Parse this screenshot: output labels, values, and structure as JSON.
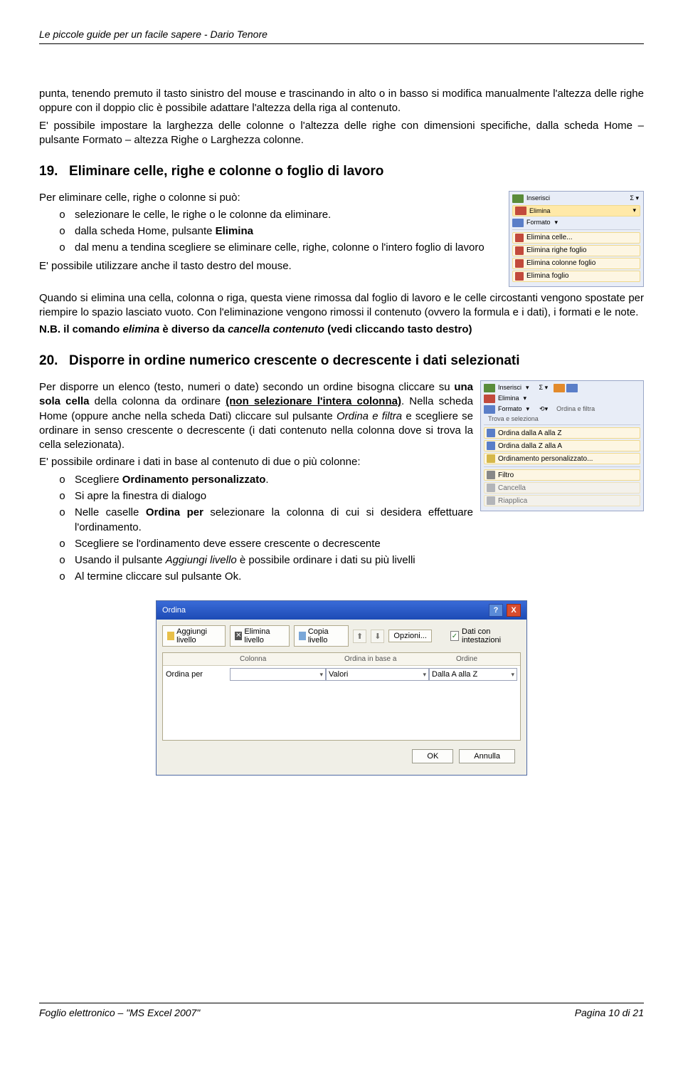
{
  "header": "Le piccole guide per un facile sapere - Dario Tenore",
  "p1": "punta, tenendo premuto il tasto sinistro del mouse e trascinando in alto o in basso si modifica manualmente l'altezza delle righe oppure con il doppio clic è possibile adattare l'altezza della riga al contenuto.",
  "p2": "E' possibile impostare la larghezza delle colonne o l'altezza delle righe con dimensioni specifiche, dalla scheda Home – pulsante Formato – altezza Righe o Larghezza colonne.",
  "h19": {
    "num": "19.",
    "txt": "Eliminare celle, righe e colonne o foglio di lavoro"
  },
  "s19": {
    "intro": "Per eliminare celle, righe o colonne si può:",
    "li1": "selezionare le celle, le righe o le colonne da eliminare.",
    "li2a": "dalla scheda Home, pulsante ",
    "li2b": "Elimina",
    "li3": "dal menu a tendina scegliere se eliminare celle, righe, colonne o l'intero foglio di lavoro",
    "p3": "E' possibile utilizzare anche il tasto destro del mouse.",
    "p4": "Quando si elimina una cella, colonna o riga, questa viene rimossa dal foglio di lavoro e le celle circostanti vengono spostate per riempire lo spazio lasciato vuoto. Con l'eliminazione vengono rimossi il contenuto (ovvero la formula e i dati), i formati e le note.",
    "nb1": "N.B. il comando ",
    "nb2": "elimina",
    "nb3": " è diverso da ",
    "nb4": "cancella contenuto",
    "nb5": " (vedi cliccando tasto destro)"
  },
  "fig1": {
    "inserisci": "Inserisci",
    "elimina": "Elimina",
    "formato": "Formato",
    "m1": "Elimina celle...",
    "m2": "Elimina righe foglio",
    "m3": "Elimina colonne foglio",
    "m4": "Elimina foglio"
  },
  "h20": {
    "num": "20.",
    "txt": "Disporre in ordine numerico crescente o decrescente i dati selezionati"
  },
  "s20": {
    "p1a": "Per disporre un elenco (testo, numeri o date) secondo un ordine bisogna cliccare su ",
    "p1b": "una sola cella",
    "p1c": " della colonna da ordinare ",
    "p1d": "(non selezionare l'intera colonna)",
    "p1e": ". Nella scheda Home (oppure anche nella scheda Dati) cliccare sul pulsante ",
    "p1f": "Ordina e filtra",
    "p1g": " e scegliere se ordinare in senso crescente o decrescente (i dati contenuto nella colonna dove si trova la cella selezionata).",
    "p2": "E' possibile ordinare i dati in base al contenuto di due o più colonne:",
    "li1a": "Scegliere ",
    "li1b": "Ordinamento personalizzato",
    "li1c": ".",
    "li2": "Si apre la finestra di dialogo",
    "li3a": "Nelle caselle ",
    "li3b": "Ordina per",
    "li3c": " selezionare la colonna di cui si desidera effettuare l'ordinamento.",
    "li4": "Scegliere se l'ordinamento deve essere crescente o decrescente",
    "li5a": "Usando il pulsante ",
    "li5b": "Aggiungi livello",
    "li5c": " è possibile ordinare i dati su più livelli",
    "li6": "Al termine cliccare sul pulsante Ok."
  },
  "fig2": {
    "inserisci": "Inserisci",
    "elimina": "Elimina",
    "formato": "Formato",
    "ordina": "Ordina e filtra",
    "trova": "Trova e seleziona",
    "m1": "Ordina dalla A alla Z",
    "m2": "Ordina dalla Z alla A",
    "m3": "Ordinamento personalizzato...",
    "m4": "Filtro",
    "m5": "Cancella",
    "m6": "Riapplica"
  },
  "dialog": {
    "title": "Ordina",
    "help": "?",
    "close": "X",
    "addlvl": "Aggiungi livello",
    "dellvl": "Elimina livello",
    "cpylvl": "Copia livello",
    "opz": "Opzioni...",
    "chk": "Dati con intestazioni",
    "col_h": "Colonna",
    "base_h": "Ordina in base a",
    "ord_h": "Ordine",
    "ordper": "Ordina per",
    "valori": "Valori",
    "az": "Dalla A alla Z",
    "ok": "OK",
    "annulla": "Annulla"
  },
  "footer": {
    "left": "Foglio elettronico – \"MS Excel 2007\"",
    "right": "Pagina 10 di 21"
  }
}
